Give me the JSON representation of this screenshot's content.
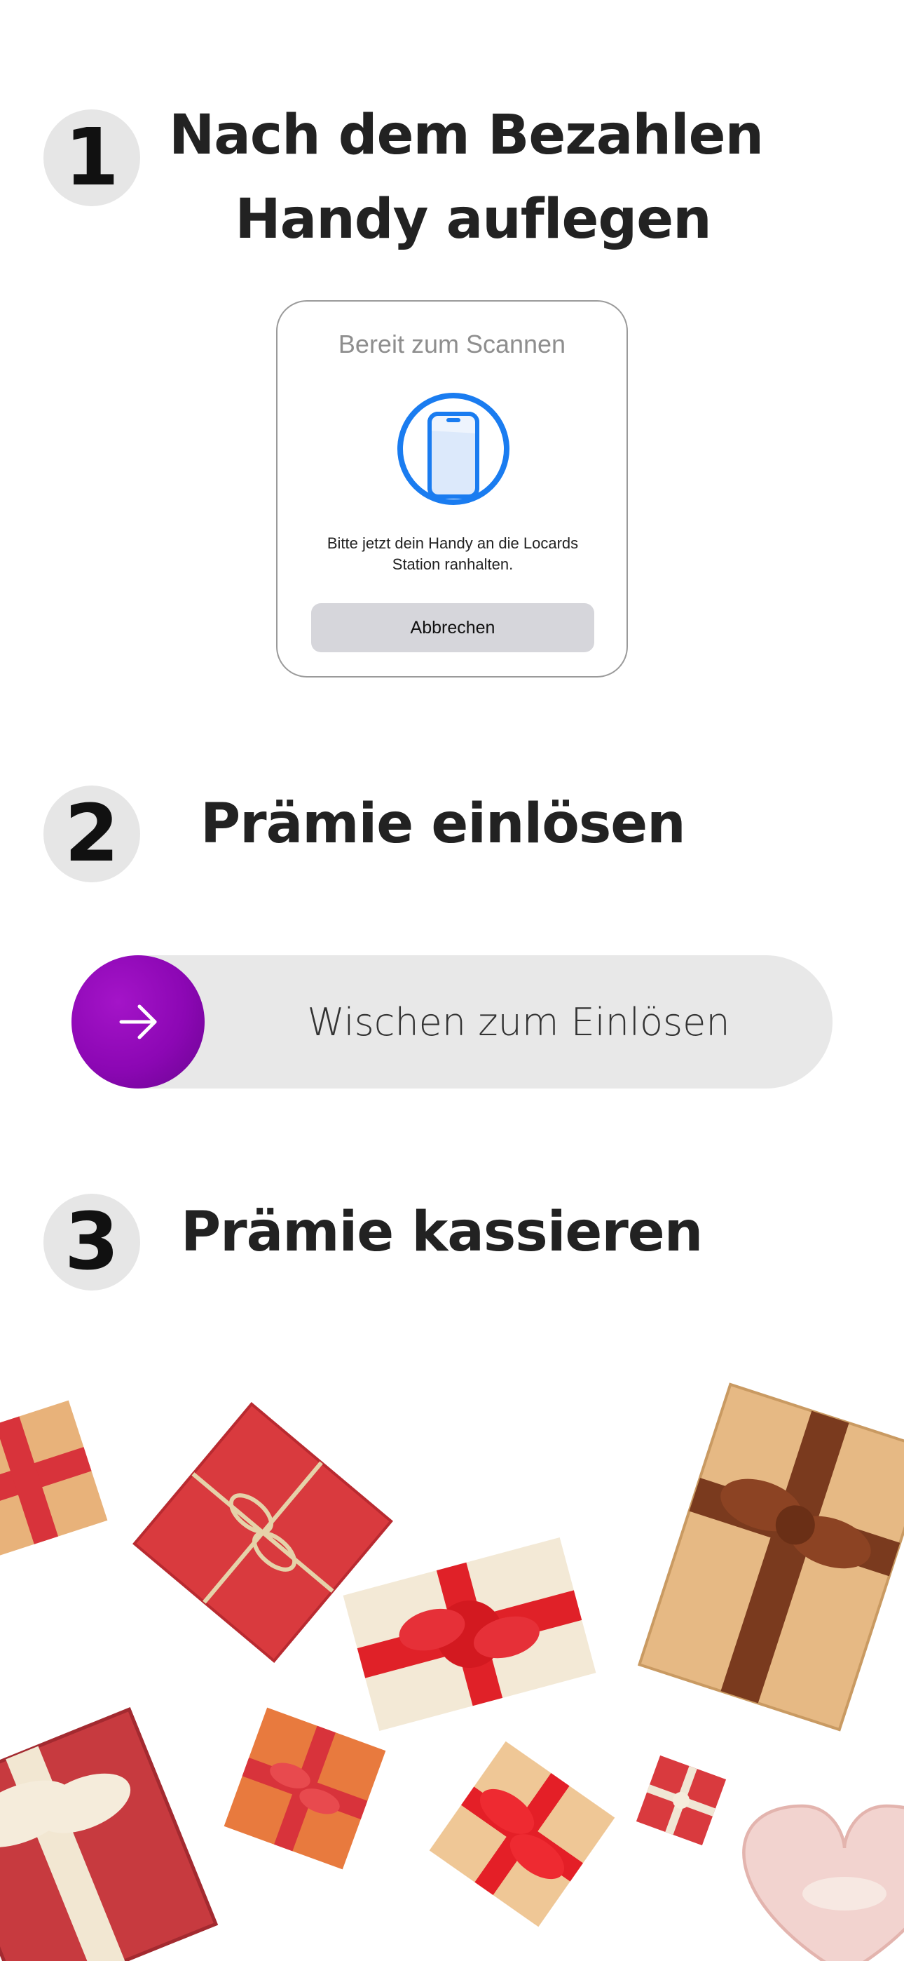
{
  "steps": [
    {
      "number": "1",
      "title_line1": "Nach dem Bezahlen",
      "title_line2": "Handy auflegen"
    },
    {
      "number": "2",
      "title": "Prämie einlösen"
    },
    {
      "number": "3",
      "title": "Prämie kassieren"
    }
  ],
  "scan_card": {
    "title": "Bereit zum Scannen",
    "instruction": "Bitte jetzt dein Handy an die Locards Station ranhalten.",
    "cancel_label": "Abbrechen",
    "icon": "phone-scan-icon",
    "accent_color": "#1a7cf0"
  },
  "swipe": {
    "label": "Wischen zum Einlösen",
    "icon": "arrow-right-icon",
    "knob_color": "#8c07b4"
  },
  "illustration": {
    "name": "gift-boxes",
    "colors": [
      "#d8333b",
      "#e8b27a",
      "#f0e4cf",
      "#e87a3e"
    ]
  }
}
